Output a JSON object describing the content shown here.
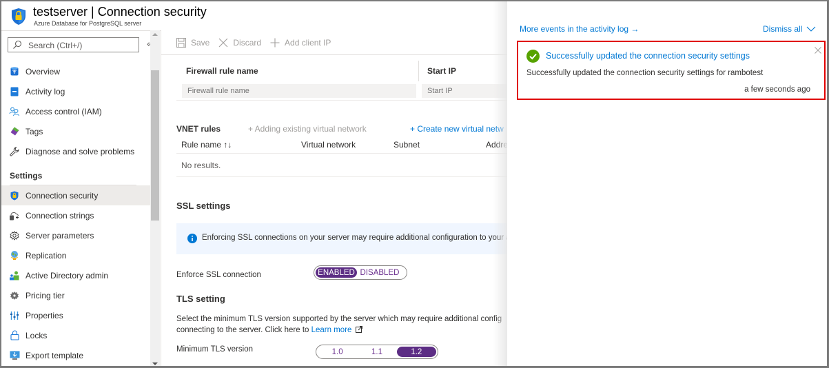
{
  "header": {
    "title": "testserver | Connection security",
    "subtitle": "Azure Database for PostgreSQL server"
  },
  "sidebar": {
    "search_placeholder": "Search (Ctrl+/)",
    "collapse_glyph": "«",
    "items_top": [
      {
        "label": "Overview",
        "icon": "overview-icon"
      },
      {
        "label": "Activity log",
        "icon": "activity-log-icon"
      },
      {
        "label": "Access control (IAM)",
        "icon": "iam-icon"
      },
      {
        "label": "Tags",
        "icon": "tag-icon"
      },
      {
        "label": "Diagnose and solve problems",
        "icon": "wrench-icon"
      }
    ],
    "section_label": "Settings",
    "items_settings": [
      {
        "label": "Connection security",
        "icon": "shield-lock-icon",
        "active": true
      },
      {
        "label": "Connection strings",
        "icon": "connection-strings-icon"
      },
      {
        "label": "Server parameters",
        "icon": "gear-icon"
      },
      {
        "label": "Replication",
        "icon": "globe-icon"
      },
      {
        "label": "Active Directory admin",
        "icon": "ad-admin-icon"
      },
      {
        "label": "Pricing tier",
        "icon": "pricing-gear-icon"
      },
      {
        "label": "Properties",
        "icon": "properties-icon"
      },
      {
        "label": "Locks",
        "icon": "lock-icon"
      },
      {
        "label": "Export template",
        "icon": "export-template-icon"
      }
    ]
  },
  "toolbar": {
    "save_label": "Save",
    "discard_label": "Discard",
    "add_client_ip_label": "Add client IP"
  },
  "firewall": {
    "col_rule_name": "Firewall rule name",
    "col_start_ip": "Start IP",
    "rule_name_placeholder": "Firewall rule name",
    "start_ip_placeholder": "Start IP"
  },
  "vnet": {
    "title": "VNET rules",
    "add_existing_label": "+ Adding existing virtual network",
    "create_new_label": "+ Create new virtual netw",
    "columns": [
      "Rule name ↑↓",
      "Virtual network",
      "Subnet",
      "Addre"
    ],
    "empty_text": "No results."
  },
  "ssl": {
    "title": "SSL settings",
    "info_text": "Enforcing SSL connections on your server may require additional configuration to your applic",
    "enforce_label": "Enforce SSL connection",
    "options": [
      "ENABLED",
      "DISABLED"
    ],
    "selected": "ENABLED"
  },
  "tls": {
    "title": "TLS setting",
    "desc_line1": "Select the minimum TLS version supported by the server which may require additional config",
    "desc_line2": "connecting to the server. Click here to ",
    "learn_more": "Learn more",
    "min_label": "Minimum TLS version",
    "options": [
      "1.0",
      "1.1",
      "1.2"
    ],
    "selected": "1.2"
  },
  "notifications": {
    "more_events": "More events in the activity log →",
    "dismiss_all": "Dismiss all",
    "card": {
      "title": "Successfully updated the connection security settings",
      "body": "Successfully updated the connection security settings for rambotest",
      "time": "a few seconds ago",
      "status": "success",
      "highlight_color": "#e00000"
    }
  },
  "colors": {
    "accent": "#0078d4",
    "toggle_selected": "#5c2d84",
    "success": "#57a300"
  }
}
